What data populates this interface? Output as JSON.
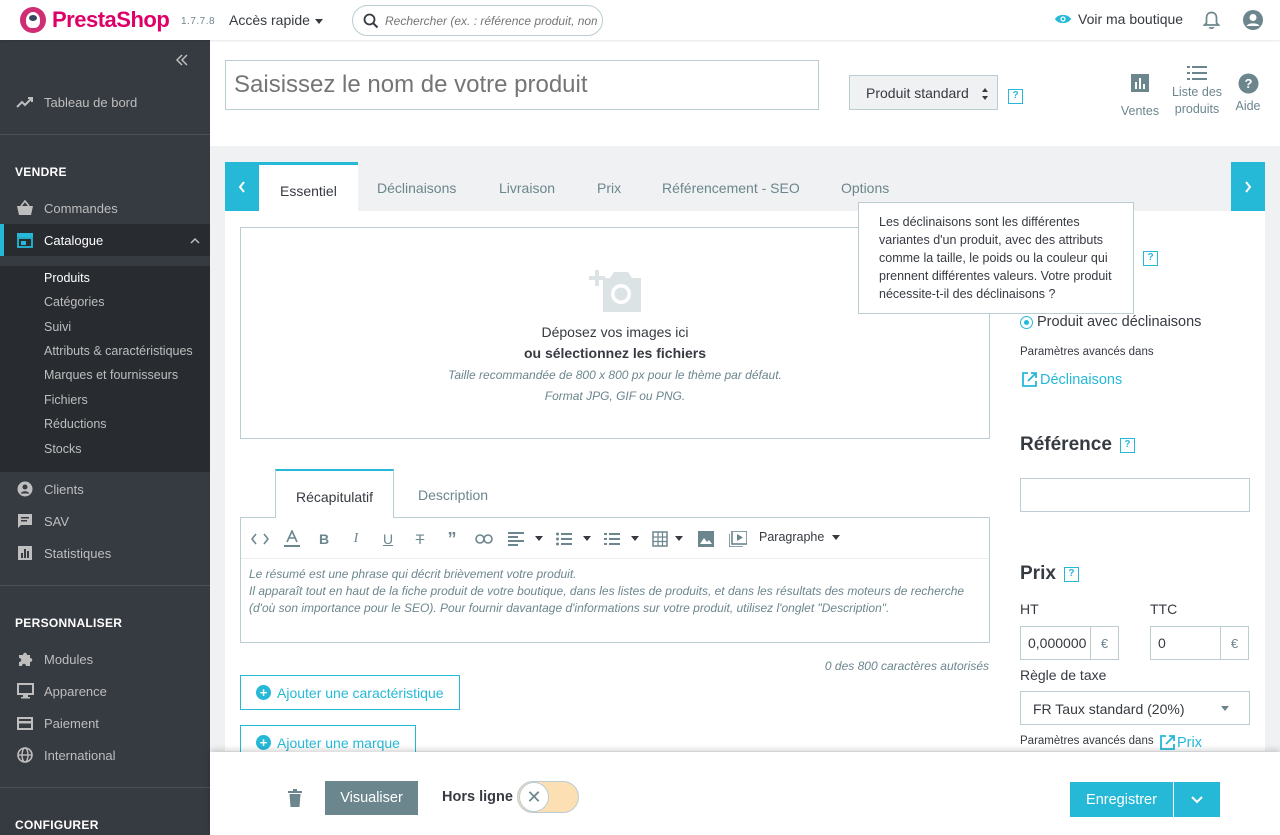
{
  "header": {
    "logo_part1": "Presta",
    "logo_part2": "Shop",
    "version": "1.7.7.8",
    "quick_access": "Accès rapide",
    "search_placeholder": "Rechercher (ex. : référence produit, nom",
    "view_shop": "Voir ma boutique",
    "colors": {
      "accent": "#25b9d7",
      "brand": "#df0067",
      "sidebar": "#363a41"
    }
  },
  "sidebar": {
    "collapse_icon": "double-chevron-left",
    "dashboard": "Tableau de bord",
    "sections": {
      "sell": "VENDRE",
      "customize": "PERSONNALISER",
      "configure": "CONFIGURER"
    },
    "sell_items": [
      {
        "label": "Commandes",
        "icon": "basket-icon"
      },
      {
        "label": "Catalogue",
        "icon": "store-icon"
      },
      {
        "label": "Clients",
        "icon": "account-icon"
      },
      {
        "label": "SAV",
        "icon": "chat-icon"
      },
      {
        "label": "Statistiques",
        "icon": "chart-icon"
      }
    ],
    "catalogue_sub": [
      "Produits",
      "Catégories",
      "Suivi",
      "Attributs & caractéristiques",
      "Marques et fournisseurs",
      "Fichiers",
      "Réductions",
      "Stocks"
    ],
    "customize_items": [
      {
        "label": "Modules",
        "icon": "puzzle-icon"
      },
      {
        "label": "Apparence",
        "icon": "desktop-icon"
      },
      {
        "label": "Paiement",
        "icon": "card-icon"
      },
      {
        "label": "International",
        "icon": "globe-icon"
      }
    ]
  },
  "product": {
    "name_placeholder": "Saisissez le nom de votre produit",
    "type_value": "Produit standard",
    "header_buttons": {
      "sales": "Ventes",
      "list_line1": "Liste des",
      "list_line2": "produits",
      "help": "Aide"
    }
  },
  "tabs": [
    "Essentiel",
    "Déclinaisons",
    "Livraison",
    "Prix",
    "Référencement - SEO",
    "Options"
  ],
  "dropzone": {
    "line1": "Déposez vos images ici",
    "line2": "ou sélectionnez les fichiers",
    "line3": "Taille recommandée de 800 x 800 px pour le thème par défaut.",
    "line4": "Format JPG, GIF ou PNG."
  },
  "summary": {
    "tabs": [
      "Récapitulatif",
      "Description"
    ],
    "paragraph": "Paragraphe",
    "body_line1": "Le résumé est une phrase qui décrit brièvement votre produit.",
    "body_line2": "Il apparaît tout en haut de la fiche produit de votre boutique, dans les listes de produits, et dans les résultats des moteurs de recherche",
    "body_line3": "(d'où son importance pour le SEO). Pour fournir davantage d'informations sur votre produit, utilisez l'onglet \"Description\".",
    "char_count": "0 des 800 caractères autorisés",
    "add_feature": "Ajouter une caractéristique",
    "add_brand": "Ajouter une marque"
  },
  "right": {
    "tooltip": "Les déclinaisons sont les différentes variantes d'un produit, avec des attributs comme la taille, le poids ou la couleur qui prennent différentes valeurs. Votre produit nécessite-t-il des déclinaisons ?",
    "radio_label": "Produit avec déclinaisons",
    "advanced_in": "Paramètres avancés dans",
    "combinations_link": "Déclinaisons",
    "reference_title": "Référence",
    "price_title": "Prix",
    "ht_label": "HT",
    "ttc_label": "TTC",
    "ht_value": "0,000000",
    "ttc_value": "0",
    "currency": "€",
    "tax_rule_label": "Règle de taxe",
    "tax_rule_value": "FR Taux standard (20%)",
    "price_link": "Prix",
    "help_mark": "?"
  },
  "footer": {
    "preview": "Visualiser",
    "offline": "Hors ligne",
    "save": "Enregistrer"
  }
}
